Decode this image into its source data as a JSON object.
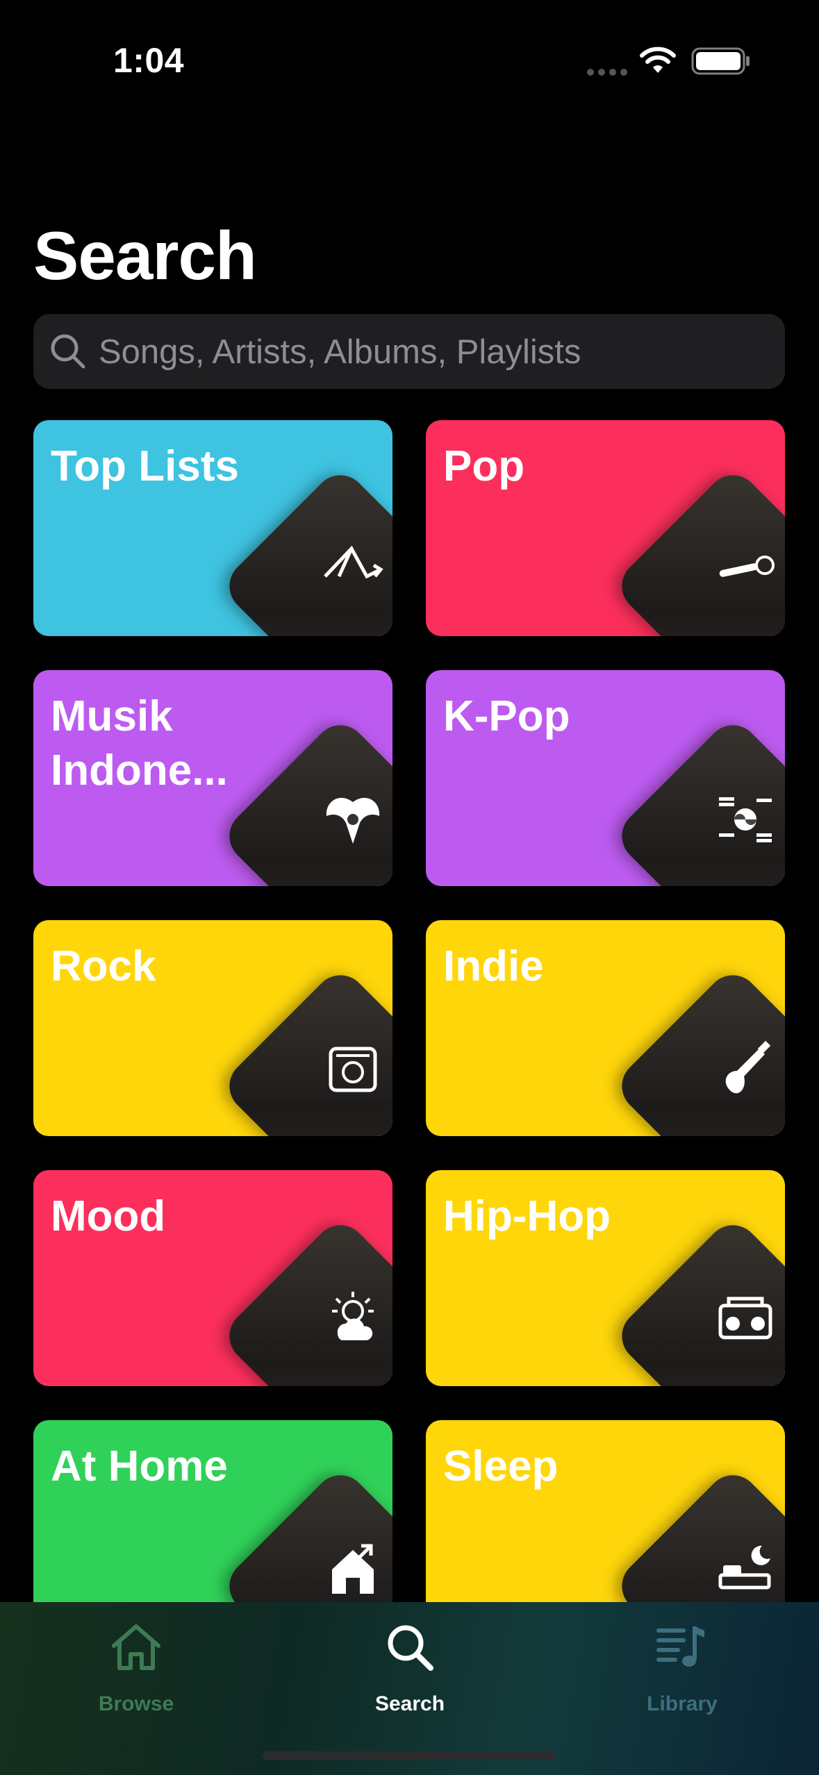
{
  "status_bar": {
    "time": "1:04"
  },
  "page_title": "Search",
  "search": {
    "placeholder": "Songs, Artists, Albums, Playlists"
  },
  "categories": [
    {
      "label": "Top Lists",
      "color": "#3ec3e0",
      "icon": "chart-arrows-icon"
    },
    {
      "label": "Pop",
      "color": "#fc2f5c",
      "icon": "microphone-icon"
    },
    {
      "label": "Musik Indone...",
      "color": "#bd5bf0",
      "icon": "garuda-icon"
    },
    {
      "label": "K-Pop",
      "color": "#bd5bf0",
      "icon": "korea-flag-icon"
    },
    {
      "label": "Rock",
      "color": "#ffd60a",
      "icon": "amplifier-icon"
    },
    {
      "label": "Indie",
      "color": "#ffd60a",
      "icon": "electric-guitar-icon"
    },
    {
      "label": "Mood",
      "color": "#fc2f5c",
      "icon": "sun-cloud-icon"
    },
    {
      "label": "Hip-Hop",
      "color": "#ffd60a",
      "icon": "boombox-icon"
    },
    {
      "label": "At Home",
      "color": "#30d158",
      "icon": "house-arrow-icon"
    },
    {
      "label": "Sleep",
      "color": "#ffd60a",
      "icon": "bed-moon-icon"
    }
  ],
  "tab_bar": {
    "tabs": [
      {
        "label": "Browse",
        "icon": "home-icon",
        "active": false
      },
      {
        "label": "Search",
        "icon": "search-icon",
        "active": true
      },
      {
        "label": "Library",
        "icon": "music-library-icon",
        "active": false
      }
    ]
  }
}
